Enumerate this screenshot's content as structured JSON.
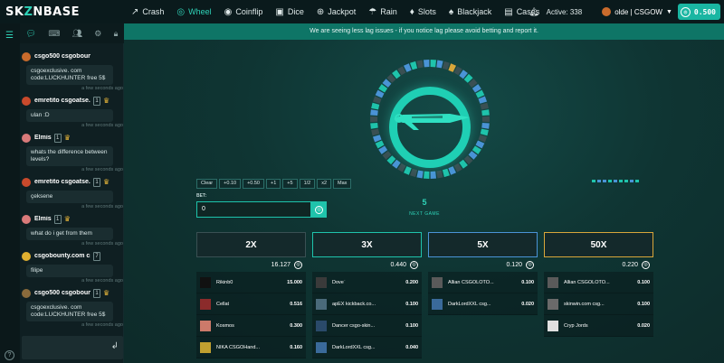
{
  "brand": {
    "left": "SK",
    "mid": "Z",
    "right": "NBASE"
  },
  "nav": {
    "items": [
      {
        "label": "Crash",
        "icon": "trend-icon",
        "glyph": "↗",
        "active": false
      },
      {
        "label": "Wheel",
        "icon": "wheel-icon",
        "glyph": "◎",
        "active": true
      },
      {
        "label": "Coinflip",
        "icon": "coin-icon",
        "glyph": "◉",
        "active": false
      },
      {
        "label": "Dice",
        "icon": "dice-icon",
        "glyph": "▣",
        "active": false
      },
      {
        "label": "Jackpot",
        "icon": "jackpot-icon",
        "glyph": "⊕",
        "active": false
      },
      {
        "label": "Rain",
        "icon": "rain-icon",
        "glyph": "☂",
        "active": false
      },
      {
        "label": "Slots",
        "icon": "slots-icon",
        "glyph": "♦",
        "active": false
      },
      {
        "label": "Blackjack",
        "icon": "cards-icon",
        "glyph": "♠",
        "active": false
      },
      {
        "label": "Cases",
        "icon": "case-icon",
        "glyph": "▤",
        "active": false
      }
    ],
    "active_label": "Active: 338",
    "username": "olde | CSGOW",
    "balance": "0.500"
  },
  "banner": "We are seeing less lag issues - if you notice lag please avoid betting and report it.",
  "chat": {
    "messages": [
      {
        "name": "csgo500 csgobounty.c...",
        "level": "",
        "crown": false,
        "avatar": "#c96b2c",
        "body": "csgoexclusive. com code:LUCKHUNTER free 5$",
        "time": "a few seconds ago"
      },
      {
        "name": "emretito csgoatse...",
        "level": "1",
        "crown": true,
        "avatar": "#c94a2c",
        "body": "ulan :D",
        "time": "a few seconds ago"
      },
      {
        "name": "Elmis",
        "level": "1",
        "crown": true,
        "avatar": "#d97a7a",
        "body": "whats the difference between levels?",
        "time": "a few seconds ago"
      },
      {
        "name": "emretito csgoatse...",
        "level": "1",
        "crown": true,
        "avatar": "#c94a2c",
        "body": "çeksene",
        "time": "a few seconds ago"
      },
      {
        "name": "Elmis",
        "level": "1",
        "crown": true,
        "avatar": "#d97a7a",
        "body": "what do i get from them",
        "time": "a few seconds ago"
      },
      {
        "name": "csgobounty.com csgo...",
        "level": "7",
        "crown": false,
        "avatar": "#e0b030",
        "body": "filipe",
        "time": "a few seconds ago"
      },
      {
        "name": "csgo500 csgobounty.c...",
        "level": "1",
        "crown": true,
        "avatar": "#8a6b3c",
        "body": "csgoexclusive. com code:LUCKHUNTER free 5$",
        "time": "a few seconds ago"
      }
    ]
  },
  "game": {
    "next_value": "5",
    "next_label": "NEXT GAME",
    "bet_label": "BET:",
    "bet_value": "0",
    "bet_buttons": [
      "Clear",
      "+0.10",
      "+0.50",
      "+1",
      "+5",
      "1/2",
      "x2",
      "Max"
    ]
  },
  "colors": {
    "accent": "#2fd3b8",
    "blue": "#4a93d6",
    "gold": "#d9a63a",
    "grey": "#3a5053"
  },
  "history": [
    "#1fc3ab",
    "#4a93d6",
    "#4a93d6",
    "#1fc3ab",
    "#4a93d6",
    "#1fc3ab",
    "#1fc3ab",
    "#4a93d6",
    "#1fc3ab"
  ],
  "columns": [
    {
      "mult": "2X",
      "accent": "grey",
      "total": "16.127",
      "rows": [
        {
          "name": "Rikinb0",
          "value": "15.000",
          "avatar": "#111111"
        },
        {
          "name": "Cellat",
          "value": "0.516",
          "avatar": "#8b2b2b"
        },
        {
          "name": "Kosmos",
          "value": "0.300",
          "avatar": "#cc7a6a"
        },
        {
          "name": "NIKA CSGOHand...",
          "value": "0.160",
          "avatar": "#c0a030"
        }
      ]
    },
    {
      "mult": "3X",
      "accent": "green",
      "total": "0.440",
      "rows": [
        {
          "name": "Dove`",
          "value": "0.200",
          "avatar": "#3a3a3a"
        },
        {
          "name": "apEX kickback.co...",
          "value": "0.100",
          "avatar": "#4a6a7a"
        },
        {
          "name": "Dancer csgo-skin...",
          "value": "0.100",
          "avatar": "#2a4a6a"
        },
        {
          "name": "DarkLordXXL csg...",
          "value": "0.040",
          "avatar": "#3a6a9a"
        }
      ]
    },
    {
      "mult": "5X",
      "accent": "blue",
      "total": "0.120",
      "rows": [
        {
          "name": "Allian CSGOLOTO...",
          "value": "0.100",
          "avatar": "#5a5a5a"
        },
        {
          "name": "DarkLordXXL csg...",
          "value": "0.020",
          "avatar": "#3a6a9a"
        }
      ]
    },
    {
      "mult": "50X",
      "accent": "gold",
      "total": "0.220",
      "rows": [
        {
          "name": "Allian CSGOLOTO...",
          "value": "0.100",
          "avatar": "#5a5a5a"
        },
        {
          "name": "skinwin.com csg...",
          "value": "0.100",
          "avatar": "#6a6a6a"
        },
        {
          "name": "Cryp Jords",
          "value": "0.020",
          "avatar": "#e0e0e0"
        }
      ]
    }
  ]
}
